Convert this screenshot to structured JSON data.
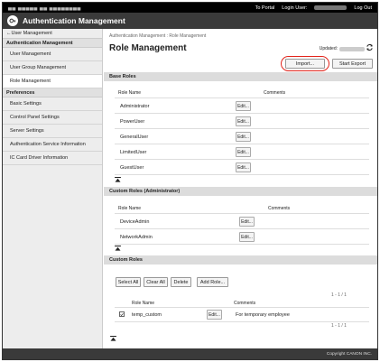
{
  "topbar": {
    "device": "▄▄ ▄▄▄▄▄ ▄▄ ▄▄▄▄▄▄▄▄",
    "to_portal": "To Portal",
    "login_user_label": "Login User:",
    "logout": "Log Out"
  },
  "header": {
    "title": "Authentication Management"
  },
  "sidebar": {
    "back": "User Management",
    "group1": "Authentication Management",
    "items1": [
      "User Management",
      "User Group Management",
      "Role Management"
    ],
    "group2": "Preferences",
    "items2": [
      "Basic Settings",
      "Control Panel Settings",
      "Server Settings",
      "Authentication Service Information",
      "IC Card Driver Information"
    ]
  },
  "main": {
    "breadcrumb": "Authentication Management : Role Management",
    "title": "Role Management",
    "updated_label": "Updated:",
    "import_label": "Import...",
    "export_label": "Start Export"
  },
  "base_roles": {
    "header": "Base Roles",
    "col_name": "Role Name",
    "col_comments": "Comments",
    "edit_label": "Edit...",
    "rows": [
      "Administrator",
      "PowerUser",
      "GeneralUser",
      "LimitedUser",
      "GuestUser"
    ]
  },
  "custom_admin": {
    "header": "Custom Roles (Administrator)",
    "col_name": "Role Name",
    "col_comments": "Comments",
    "edit_label": "Edit...",
    "rows": [
      "DeviceAdmin",
      "NetworkAdmin"
    ]
  },
  "custom_roles": {
    "header": "Custom Roles",
    "select_all": "Select All",
    "clear_all": "Clear All",
    "delete": "Delete",
    "add_role": "Add Role...",
    "count": "1 - 1 / 1",
    "col_name": "Role Name",
    "col_comments": "Comments",
    "edit_label": "Edit...",
    "rows": [
      {
        "name": "temp_custom",
        "comment": "For temporary employee",
        "checked": true
      }
    ]
  },
  "footer": {
    "copyright": "Copyright CANON INC."
  },
  "colors": {
    "accent_ring": "#e2231a",
    "header_bg": "#3a3a3a",
    "topbar_bg": "#000000",
    "section_bg": "#dcdcdc"
  }
}
